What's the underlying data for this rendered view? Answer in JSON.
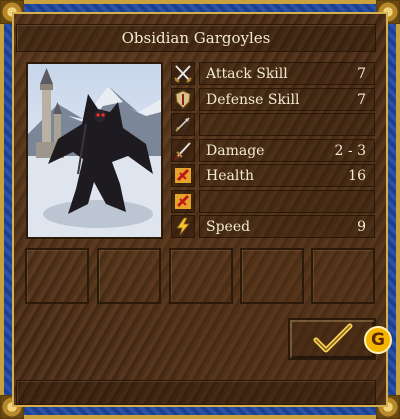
{
  "creature": {
    "name": "Obsidian Gargoyles"
  },
  "stats": [
    {
      "icon": "crossed-swords-icon",
      "label": "Attack Skill",
      "value": "7"
    },
    {
      "icon": "shield-icon",
      "label": "Defense Skill",
      "value": "7"
    },
    {
      "icon": "arrow-icon",
      "label": "",
      "value": ""
    },
    {
      "icon": "sword-icon",
      "label": "Damage",
      "value": "2 - 3"
    },
    {
      "icon": "red-cross-icon",
      "label": "Health",
      "value": "16"
    },
    {
      "icon": "red-cross-icon",
      "label": "",
      "value": ""
    },
    {
      "icon": "lightning-icon",
      "label": "Speed",
      "value": "9"
    }
  ],
  "ability_slots": 5,
  "watermark": "G",
  "colors": {
    "text": "#f3ead2",
    "frame_blue": "#2a52aa",
    "gold": "#c9a23d",
    "leather": "#4a2e16"
  }
}
